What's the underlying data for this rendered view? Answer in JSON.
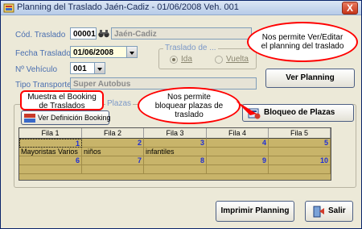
{
  "window": {
    "title": "Planning del Traslado Jaén-Cadiz - 01/06/2008 Veh. 001",
    "close_label": "X"
  },
  "form": {
    "cod_traslado_label": "Cód. Traslado",
    "cod_traslado_value": "00001",
    "cod_traslado_name": "Jaén-Cadiz",
    "fecha_label": "Fecha Traslado",
    "fecha_value": "01/06/2008",
    "vehiculo_label": "Nº Vehículo",
    "vehiculo_value": "001",
    "tipo_label": "Tipo Transporte",
    "tipo_value": "Super Autobus",
    "traslado_group_title": "Traslado de ...",
    "radio_ida": "Ida",
    "radio_vuelta": "Vuelta",
    "radio_selected": "Ida",
    "plazas_group_title": "Plazas"
  },
  "buttons": {
    "ver_planning": "Ver Planning",
    "ver_definicion": "Ver Definición Booking",
    "bloqueo": "Bloqueo de Plazas",
    "imprimir": "Imprimir Planning",
    "salir": "Salir"
  },
  "callouts": {
    "planning": "Nos permite Ver/Editar el planning del traslado",
    "booking": "Muestra el Booking de Traslados",
    "bloqueo": "Nos permite bloquear plazas de traslado"
  },
  "grid": {
    "headers": [
      "Fila 1",
      "Fila 2",
      "Fila 3",
      "Fila 4",
      "Fila 5"
    ],
    "rows": [
      [
        "1",
        "2",
        "3",
        "4",
        "5"
      ],
      [
        "Mayoristas Varios",
        "niños",
        "infantiles",
        "",
        ""
      ],
      [
        "6",
        "7",
        "8",
        "9",
        "10"
      ],
      [
        "",
        "",
        "",
        "",
        ""
      ]
    ]
  },
  "colors": {
    "grid_fill": "#c8b46a",
    "number_text": "#1f2fd6",
    "callout_border": "#ff0000",
    "window_bg": "#ece9d8"
  }
}
